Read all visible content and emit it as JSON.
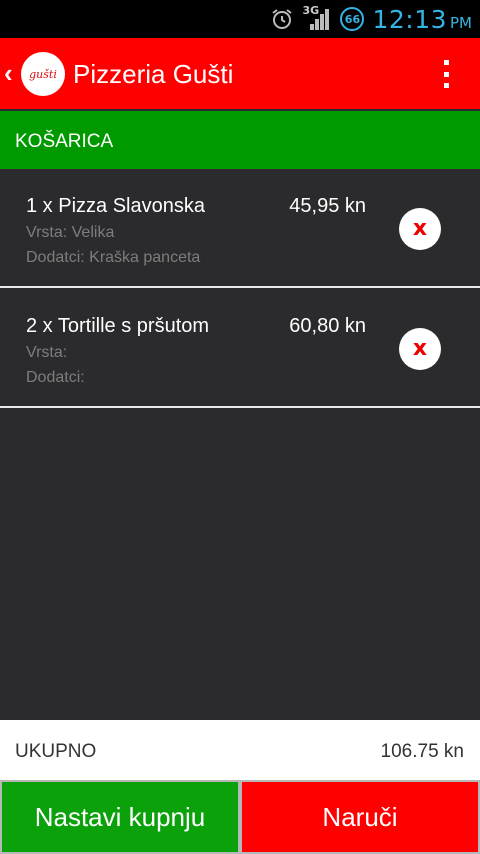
{
  "status_bar": {
    "network": "3G",
    "battery": "66",
    "time": "12:13",
    "ampm": "PM",
    "colors": {
      "accent": "#33b5e5"
    }
  },
  "action_bar": {
    "title": "Pizzeria Gušti",
    "logo_text": "gušti",
    "color": "#ff0000"
  },
  "section": {
    "title": "KOŠARICA",
    "color": "#009a00"
  },
  "cart": {
    "items": [
      {
        "name": "1 x Pizza Slavonska",
        "price": "45,95 kn",
        "vrsta": "Vrsta: Velika",
        "dodatci": "Dodatci: Kraška panceta"
      },
      {
        "name": "2 x Tortille s pršutom",
        "price": "60,80 kn",
        "vrsta": "Vrsta:",
        "dodatci": "Dodatci:"
      }
    ],
    "remove_glyph": "x"
  },
  "total": {
    "label": "UKUPNO",
    "value": "106.75 kn"
  },
  "buttons": {
    "continue_label": "Nastavi kupnju",
    "order_label": "Naruči"
  }
}
